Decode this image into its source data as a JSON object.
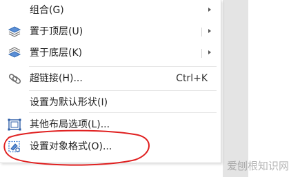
{
  "menu": {
    "items": [
      {
        "label": "组合(G)",
        "icon": "none",
        "has_submenu": true
      },
      {
        "label": "置于顶层(U)",
        "icon": "bring-to-front-icon",
        "has_submenu": true
      },
      {
        "label": "置于底层(K)",
        "icon": "send-to-back-icon",
        "has_submenu": true
      },
      {
        "label": "超链接(H)...",
        "icon": "link-icon",
        "shortcut": "Ctrl+K"
      },
      {
        "label": "设置为默认形状(I)",
        "icon": "none"
      },
      {
        "label": "其他布局选项(L)...",
        "icon": "layout-options-icon"
      },
      {
        "label": "设置对象格式(O)...",
        "icon": "format-object-icon"
      }
    ]
  },
  "annotation": {
    "type": "ellipse",
    "color": "#e02020",
    "target": "设置对象格式(O)..."
  },
  "watermark": {
    "text": "爱刨根知识网"
  },
  "colors": {
    "accent_icon": "#3a7bd5",
    "menu_text": "#222222",
    "annotation": "#e02020"
  }
}
